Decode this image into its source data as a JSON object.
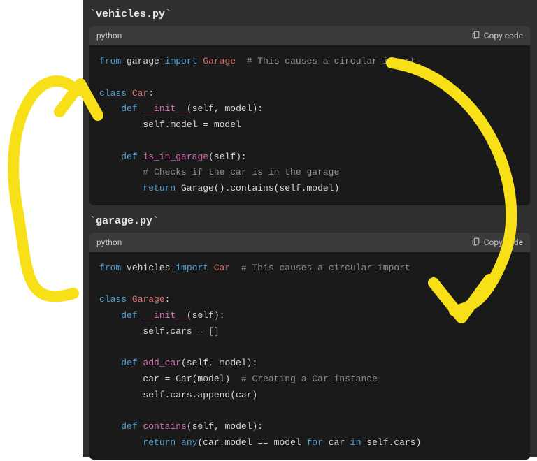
{
  "files": [
    {
      "title": "`vehicles.py`",
      "language": "python",
      "copy_label": "Copy code",
      "code_html": "<span class=\"kw\">from</span> garage <span class=\"kw\">import</span> <span class=\"cls\">Garage</span>  <span class=\"cmt\"># This causes a circular import</span>\n\n<span class=\"kw\">class</span> <span class=\"cls\">Car</span>:\n    <span class=\"kw\">def</span> <span class=\"fn\">__init__</span>(self, model):\n        self.model = model\n\n    <span class=\"kw\">def</span> <span class=\"fn\">is_in_garage</span>(self):\n        <span class=\"cmt\"># Checks if the car is in the garage</span>\n        <span class=\"kw\">return</span> Garage().contains(self.model)"
    },
    {
      "title": "`garage.py`",
      "language": "python",
      "copy_label": "Copy code",
      "code_html": "<span class=\"kw\">from</span> vehicles <span class=\"kw\">import</span> <span class=\"cls\">Car</span>  <span class=\"cmt\"># This causes a circular import</span>\n\n<span class=\"kw\">class</span> <span class=\"cls\">Garage</span>:\n    <span class=\"kw\">def</span> <span class=\"fn\">__init__</span>(self):\n        self.cars = []\n\n    <span class=\"kw\">def</span> <span class=\"fn\">add_car</span>(self, model):\n        car = Car(model)  <span class=\"cmt\"># Creating a Car instance</span>\n        self.cars.append(car)\n\n    <span class=\"kw\">def</span> <span class=\"fn\">contains</span>(self, model):\n        <span class=\"kw\">return</span> <span class=\"kw\">any</span>(car.model == model <span class=\"kw\">for</span> car <span class=\"kw\">in</span> self.cars)"
    }
  ],
  "annotation": {
    "color": "#f7e018",
    "stroke_width": 16
  }
}
